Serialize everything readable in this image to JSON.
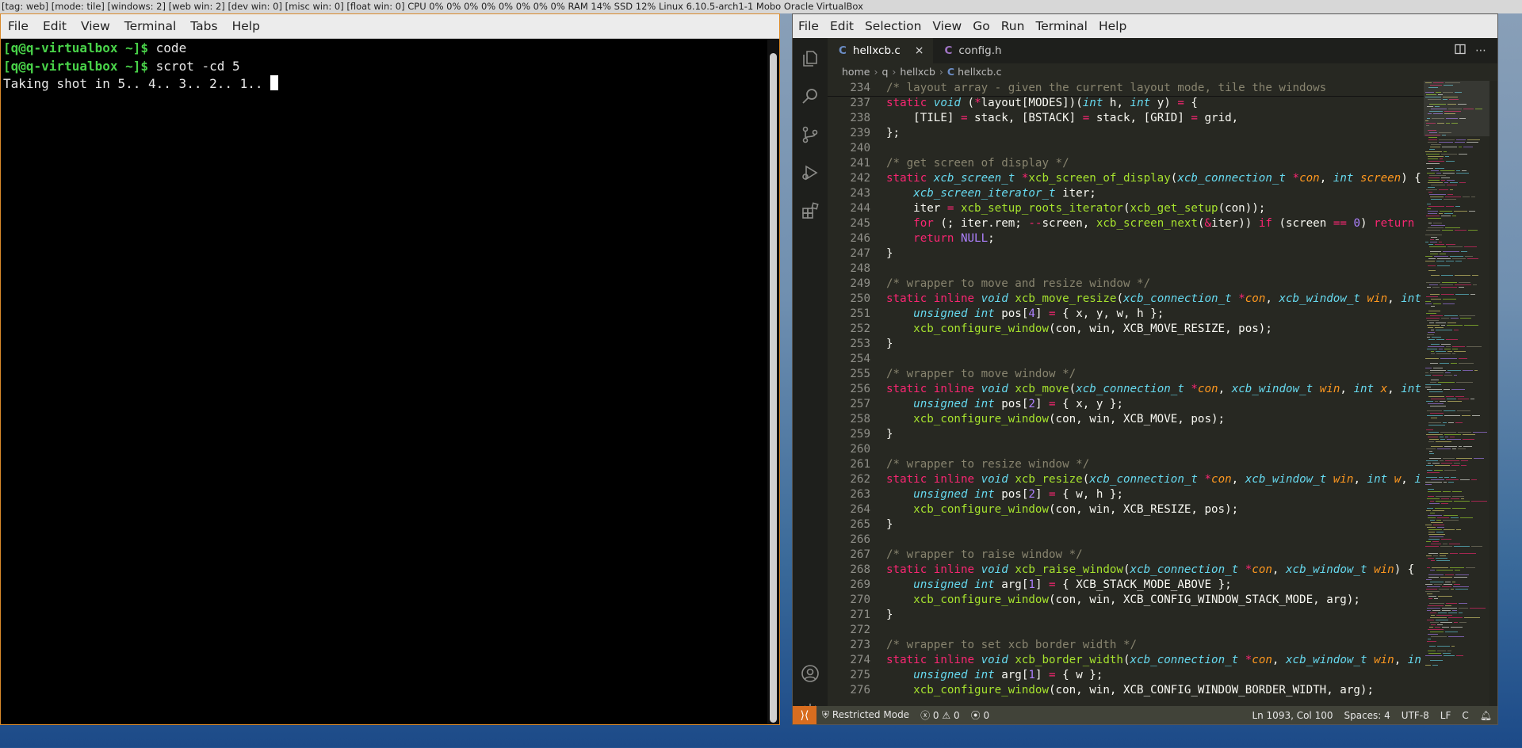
{
  "statusbar": {
    "text": "[tag: web] [mode: tile] [windows: 2] [web win: 2] [dev win: 0] [misc win: 0] [float win: 0]   CPU 0% 0% 0% 0% 0% 0% 0% 0% RAM 14% SSD 12% Linux 6.10.5-arch1-1 Mobo Oracle VirtualBox"
  },
  "terminal": {
    "menu": [
      "File",
      "Edit",
      "View",
      "Terminal",
      "Tabs",
      "Help"
    ],
    "lines": [
      {
        "prompt": "[q@q-virtualbox ~]$",
        "cmd": " code"
      },
      {
        "prompt": "[q@q-virtualbox ~]$",
        "cmd": " scrot -cd 5"
      },
      {
        "prompt": "",
        "cmd": "Taking shot in 5.. 4.. 3.. 2.. 1.. "
      }
    ]
  },
  "vscode": {
    "menu": [
      "File",
      "Edit",
      "Selection",
      "View",
      "Go",
      "Run",
      "Terminal",
      "Help"
    ],
    "tabs": [
      {
        "label": "hellxcb.c",
        "letter": "C",
        "close": "×",
        "active": true
      },
      {
        "label": "config.h",
        "letter": "C",
        "close": "",
        "active": false
      }
    ],
    "breadcrumb": {
      "parts": [
        "home",
        "q",
        "hellxcb"
      ],
      "file": "hellxcb.c",
      "letter": "C"
    },
    "status": {
      "mode": "Restricted Mode",
      "errors": "0",
      "warnings": "0",
      "ports": "0",
      "position": "Ln 1093, Col 100",
      "spaces": "Spaces: 4",
      "encoding": "UTF-8",
      "eol": "LF",
      "lang": "C"
    },
    "activity_icons": [
      "explorer-icon",
      "search-icon",
      "source-control-icon",
      "run-debug-icon",
      "extensions-icon",
      "account-icon",
      "settings-gear-icon"
    ],
    "code": [
      {
        "n": "234",
        "sticky": true,
        "html": "<span class=\"cm\">/* layout array - given the current layout mode, tile the windows</span>"
      },
      {
        "n": "237",
        "html": "<span class=\"k\">static</span> <span class=\"t\">void</span> (<span class=\"k\">*</span>layout[MODES])(<span class=\"t\">int</span> h, <span class=\"t\">int</span> y) <span class=\"k\">=</span> {"
      },
      {
        "n": "238",
        "html": "    [TILE] <span class=\"k\">=</span> stack, [BSTACK] <span class=\"k\">=</span> stack, [GRID] <span class=\"k\">=</span> grid,"
      },
      {
        "n": "239",
        "html": "};"
      },
      {
        "n": "240",
        "html": ""
      },
      {
        "n": "241",
        "html": "<span class=\"cm\">/* get screen of display */</span>"
      },
      {
        "n": "242",
        "html": "<span class=\"k\">static</span> <span class=\"t\">xcb_screen_t</span> <span class=\"k\">*</span><span class=\"f\">xcb_screen_of_display</span>(<span class=\"t\">xcb_connection_t</span> <span class=\"k\">*</span><span class=\"p\">con</span>, <span class=\"t\">int</span> <span class=\"p\">screen</span>) {"
      },
      {
        "n": "243",
        "html": "    <span class=\"t\">xcb_screen_iterator_t</span> iter;"
      },
      {
        "n": "244",
        "html": "    iter <span class=\"k\">=</span> <span class=\"f\">xcb_setup_roots_iterator</span>(<span class=\"f\">xcb_get_setup</span>(con));"
      },
      {
        "n": "245",
        "html": "    <span class=\"k\">for</span> (; iter.rem; <span class=\"k\">--</span>screen, <span class=\"f\">xcb_screen_next</span>(<span class=\"k\">&amp;</span>iter)) <span class=\"k\">if</span> (screen <span class=\"k\">==</span> <span class=\"n\">0</span>) <span class=\"k\">return</span>"
      },
      {
        "n": "246",
        "html": "    <span class=\"k\">return</span> <span class=\"n\">NULL</span>;"
      },
      {
        "n": "247",
        "html": "}"
      },
      {
        "n": "248",
        "html": ""
      },
      {
        "n": "249",
        "html": "<span class=\"cm\">/* wrapper to move and resize window */</span>"
      },
      {
        "n": "250",
        "html": "<span class=\"k\">static</span> <span class=\"k\">inline</span> <span class=\"t\">void</span> <span class=\"f\">xcb_move_resize</span>(<span class=\"t\">xcb_connection_t</span> <span class=\"k\">*</span><span class=\"p\">con</span>, <span class=\"t\">xcb_window_t</span> <span class=\"p\">win</span>, <span class=\"t\">int</span>"
      },
      {
        "n": "251",
        "html": "    <span class=\"t\">unsigned</span> <span class=\"t\">int</span> pos[<span class=\"n\">4</span>] <span class=\"k\">=</span> { x, y, w, h };"
      },
      {
        "n": "252",
        "html": "    <span class=\"f\">xcb_configure_window</span>(con, win, XCB_MOVE_RESIZE, pos);"
      },
      {
        "n": "253",
        "html": "}"
      },
      {
        "n": "254",
        "html": ""
      },
      {
        "n": "255",
        "html": "<span class=\"cm\">/* wrapper to move window */</span>"
      },
      {
        "n": "256",
        "html": "<span class=\"k\">static</span> <span class=\"k\">inline</span> <span class=\"t\">void</span> <span class=\"f\">xcb_move</span>(<span class=\"t\">xcb_connection_t</span> <span class=\"k\">*</span><span class=\"p\">con</span>, <span class=\"t\">xcb_window_t</span> <span class=\"p\">win</span>, <span class=\"t\">int</span> <span class=\"p\">x</span>, <span class=\"t\">int</span>"
      },
      {
        "n": "257",
        "html": "    <span class=\"t\">unsigned</span> <span class=\"t\">int</span> pos[<span class=\"n\">2</span>] <span class=\"k\">=</span> { x, y };"
      },
      {
        "n": "258",
        "html": "    <span class=\"f\">xcb_configure_window</span>(con, win, XCB_MOVE, pos);"
      },
      {
        "n": "259",
        "html": "}"
      },
      {
        "n": "260",
        "html": ""
      },
      {
        "n": "261",
        "html": "<span class=\"cm\">/* wrapper to resize window */</span>"
      },
      {
        "n": "262",
        "html": "<span class=\"k\">static</span> <span class=\"k\">inline</span> <span class=\"t\">void</span> <span class=\"f\">xcb_resize</span>(<span class=\"t\">xcb_connection_t</span> <span class=\"k\">*</span><span class=\"p\">con</span>, <span class=\"t\">xcb_window_t</span> <span class=\"p\">win</span>, <span class=\"t\">int</span> <span class=\"p\">w</span>, <span class=\"t\">i</span>"
      },
      {
        "n": "263",
        "html": "    <span class=\"t\">unsigned</span> <span class=\"t\">int</span> pos[<span class=\"n\">2</span>] <span class=\"k\">=</span> { w, h };"
      },
      {
        "n": "264",
        "html": "    <span class=\"f\">xcb_configure_window</span>(con, win, XCB_RESIZE, pos);"
      },
      {
        "n": "265",
        "html": "}"
      },
      {
        "n": "266",
        "html": ""
      },
      {
        "n": "267",
        "html": "<span class=\"cm\">/* wrapper to raise window */</span>"
      },
      {
        "n": "268",
        "html": "<span class=\"k\">static</span> <span class=\"k\">inline</span> <span class=\"t\">void</span> <span class=\"f\">xcb_raise_window</span>(<span class=\"t\">xcb_connection_t</span> <span class=\"k\">*</span><span class=\"p\">con</span>, <span class=\"t\">xcb_window_t</span> <span class=\"p\">win</span>) {"
      },
      {
        "n": "269",
        "html": "    <span class=\"t\">unsigned</span> <span class=\"t\">int</span> arg[<span class=\"n\">1</span>] <span class=\"k\">=</span> { XCB_STACK_MODE_ABOVE };"
      },
      {
        "n": "270",
        "html": "    <span class=\"f\">xcb_configure_window</span>(con, win, XCB_CONFIG_WINDOW_STACK_MODE, arg);"
      },
      {
        "n": "271",
        "html": "}"
      },
      {
        "n": "272",
        "html": ""
      },
      {
        "n": "273",
        "html": "<span class=\"cm\">/* wrapper to set xcb border width */</span>"
      },
      {
        "n": "274",
        "html": "<span class=\"k\">static</span> <span class=\"k\">inline</span> <span class=\"t\">void</span> <span class=\"f\">xcb_border_width</span>(<span class=\"t\">xcb_connection_t</span> <span class=\"k\">*</span><span class=\"p\">con</span>, <span class=\"t\">xcb_window_t</span> <span class=\"p\">win</span>, <span class=\"t\">in</span>"
      },
      {
        "n": "275",
        "html": "    <span class=\"t\">unsigned</span> <span class=\"t\">int</span> arg[<span class=\"n\">1</span>] <span class=\"k\">=</span> { w };"
      },
      {
        "n": "276",
        "html": "    <span class=\"f\">xcb_configure_window</span>(con, win, XCB_CONFIG_WINDOW_BORDER_WIDTH, arg);"
      }
    ]
  }
}
